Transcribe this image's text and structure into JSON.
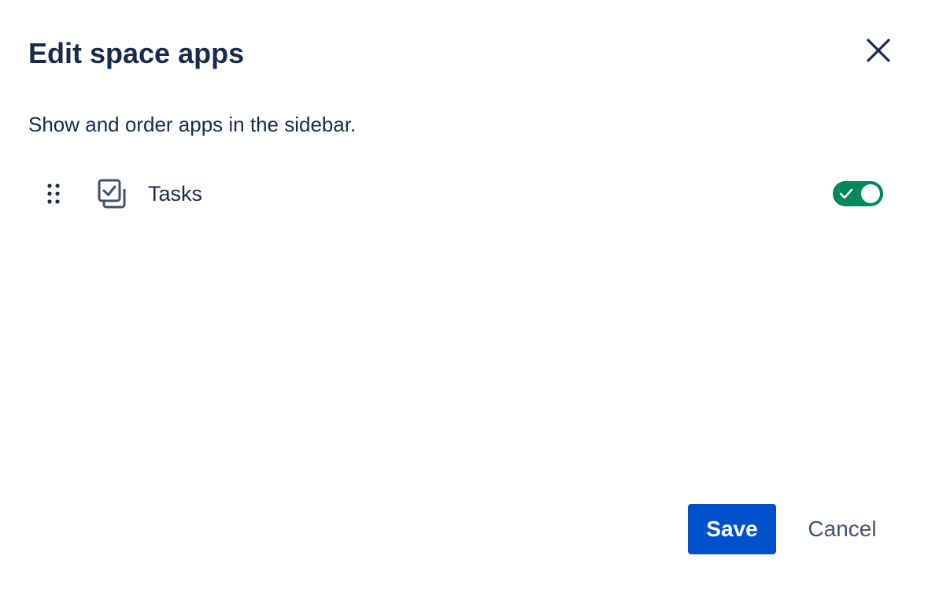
{
  "dialog": {
    "title": "Edit space apps",
    "description": "Show and order apps in the sidebar.",
    "close_icon": "close-icon"
  },
  "apps": [
    {
      "label": "Tasks",
      "icon": "tasks-checkbox-icon",
      "enabled": true
    }
  ],
  "footer": {
    "save_label": "Save",
    "cancel_label": "Cancel"
  },
  "colors": {
    "title_text": "#172b4d",
    "toggle_on": "#00875a",
    "primary_button": "#0052cc",
    "secondary_text": "#42526e"
  }
}
